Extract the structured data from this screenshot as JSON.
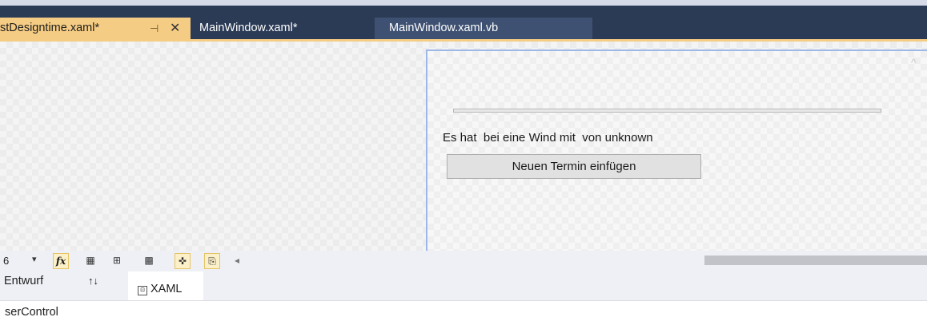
{
  "tabs": [
    {
      "label": "stDesigntime.xaml*",
      "pin": "⊣",
      "close": "✕"
    },
    {
      "label": "MainWindow.xaml*"
    },
    {
      "label": "MainWindow.xaml.vb"
    }
  ],
  "designer": {
    "status_text": "Es hat  bei eine Wind mit  von unknown",
    "add_button_label": "Neuen Termin einfügen",
    "scroll_up_icon": "^"
  },
  "toolbar": {
    "zoom_value": "6",
    "dropdown_icon": "▾",
    "fx_label": "fx",
    "grid_icon": "▦",
    "grid2_icon": "⊞",
    "checker_icon": "▩",
    "snap_icon": "✜",
    "ruler_icon": "⎘",
    "scroll_left_icon": "◂"
  },
  "views": {
    "design_label": "Entwurf",
    "swap_icon": "↑↓",
    "xaml_icon": "⊡",
    "xaml_label": "XAML"
  },
  "bottom": {
    "text": "serControl"
  },
  "colors": {
    "active_tab": "#f5cc84",
    "tab_bar": "#2b3a55",
    "selection_border": "#9db8e8"
  }
}
